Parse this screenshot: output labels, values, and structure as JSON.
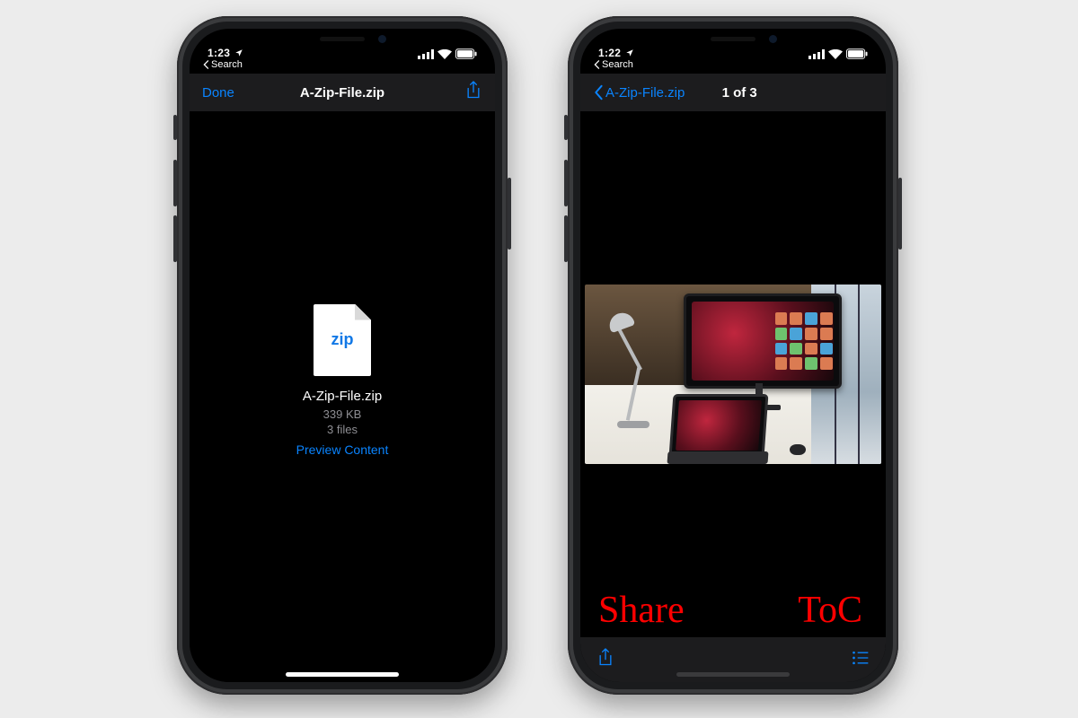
{
  "left_phone": {
    "status": {
      "time": "1:23",
      "back_label": "Search"
    },
    "nav": {
      "done_label": "Done",
      "title": "A-Zip-File.zip"
    },
    "file": {
      "icon_label": "zip",
      "name": "A-Zip-File.zip",
      "size": "339 KB",
      "count": "3 files",
      "preview_label": "Preview Content"
    }
  },
  "right_phone": {
    "status": {
      "time": "1:22",
      "back_label": "Search"
    },
    "nav": {
      "back_label": "A-Zip-File.zip",
      "title": "1 of 3"
    },
    "annotations": {
      "share": "Share",
      "toc": "ToC"
    }
  },
  "colors": {
    "tint": "#0a84ff",
    "annotation": "#ff0000"
  }
}
